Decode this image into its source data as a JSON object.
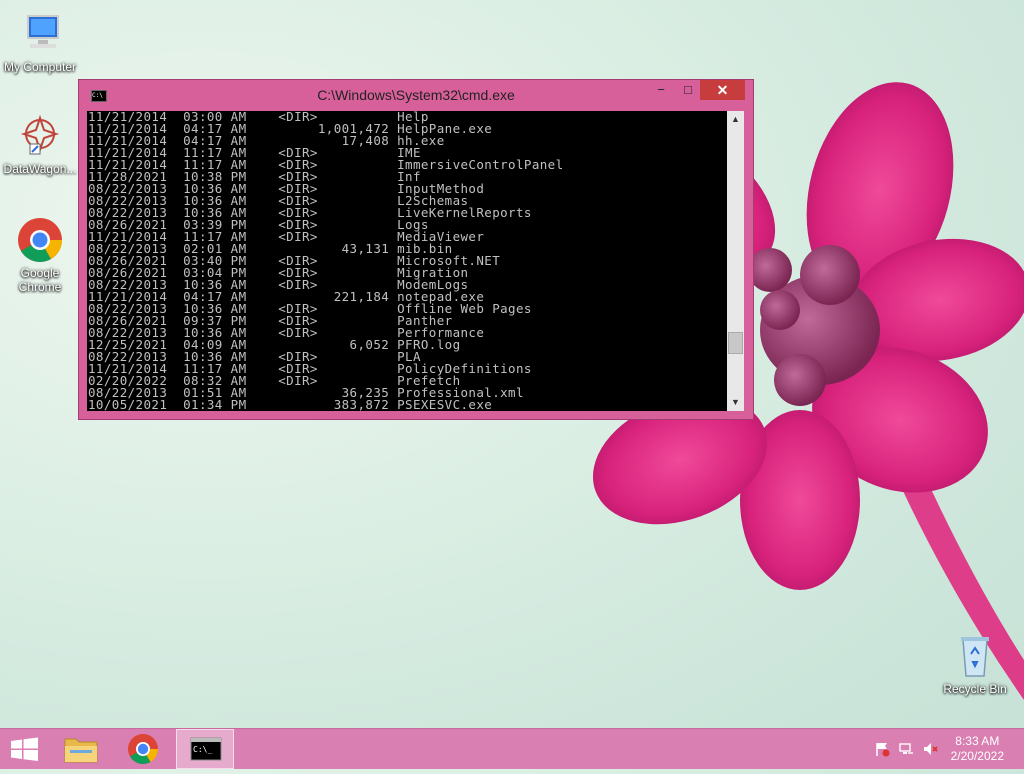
{
  "desktop": {
    "icons": [
      {
        "label": "My Computer",
        "icon": "computer-icon"
      },
      {
        "label": "DataWagon...",
        "icon": "datawagon-icon"
      },
      {
        "label": "Google Chrome",
        "icon": "chrome-icon"
      },
      {
        "label": "Recycle Bin",
        "icon": "recycle-bin-icon"
      }
    ]
  },
  "window": {
    "title": "C:\\Windows\\System32\\cmd.exe",
    "minimize": "−",
    "maximize": "□",
    "close": "✕",
    "lines": [
      "11/21/2014  03:00 AM    <DIR>          Help",
      "11/21/2014  04:17 AM         1,001,472 HelpPane.exe",
      "11/21/2014  04:17 AM            17,408 hh.exe",
      "11/21/2014  11:17 AM    <DIR>          IME",
      "11/21/2014  11:17 AM    <DIR>          ImmersiveControlPanel",
      "11/28/2021  10:38 PM    <DIR>          Inf",
      "08/22/2013  10:36 AM    <DIR>          InputMethod",
      "08/22/2013  10:36 AM    <DIR>          L2Schemas",
      "08/22/2013  10:36 AM    <DIR>          LiveKernelReports",
      "08/26/2021  03:39 PM    <DIR>          Logs",
      "11/21/2014  11:17 AM    <DIR>          MediaViewer",
      "08/22/2013  02:01 AM            43,131 mib.bin",
      "08/26/2021  03:40 PM    <DIR>          Microsoft.NET",
      "08/26/2021  03:04 PM    <DIR>          Migration",
      "08/22/2013  10:36 AM    <DIR>          ModemLogs",
      "11/21/2014  04:17 AM           221,184 notepad.exe",
      "08/22/2013  10:36 AM    <DIR>          Offline Web Pages",
      "08/26/2021  09:37 PM    <DIR>          Panther",
      "08/22/2013  10:36 AM    <DIR>          Performance",
      "12/25/2021  04:09 AM             6,052 PFRO.log",
      "08/22/2013  10:36 AM    <DIR>          PLA",
      "11/21/2014  11:17 AM    <DIR>          PolicyDefinitions",
      "02/20/2022  08:32 AM    <DIR>          Prefetch",
      "08/22/2013  01:51 AM            36,235 Professional.xml",
      "10/05/2021  01:34 PM           383,872 PSEXESVC.exe"
    ]
  },
  "taskbar": {
    "items": [
      {
        "icon": "start-windows-icon"
      },
      {
        "icon": "file-explorer-icon"
      },
      {
        "icon": "chrome-taskbar-icon"
      },
      {
        "icon": "cmd-taskbar-icon"
      }
    ],
    "clock": {
      "time": "8:33 AM",
      "date": "2/20/2022"
    }
  },
  "colors": {
    "accent": "#d97fb1",
    "close": "#c73d3d",
    "console_bg": "#000000",
    "console_fg": "#c0c0c0"
  }
}
